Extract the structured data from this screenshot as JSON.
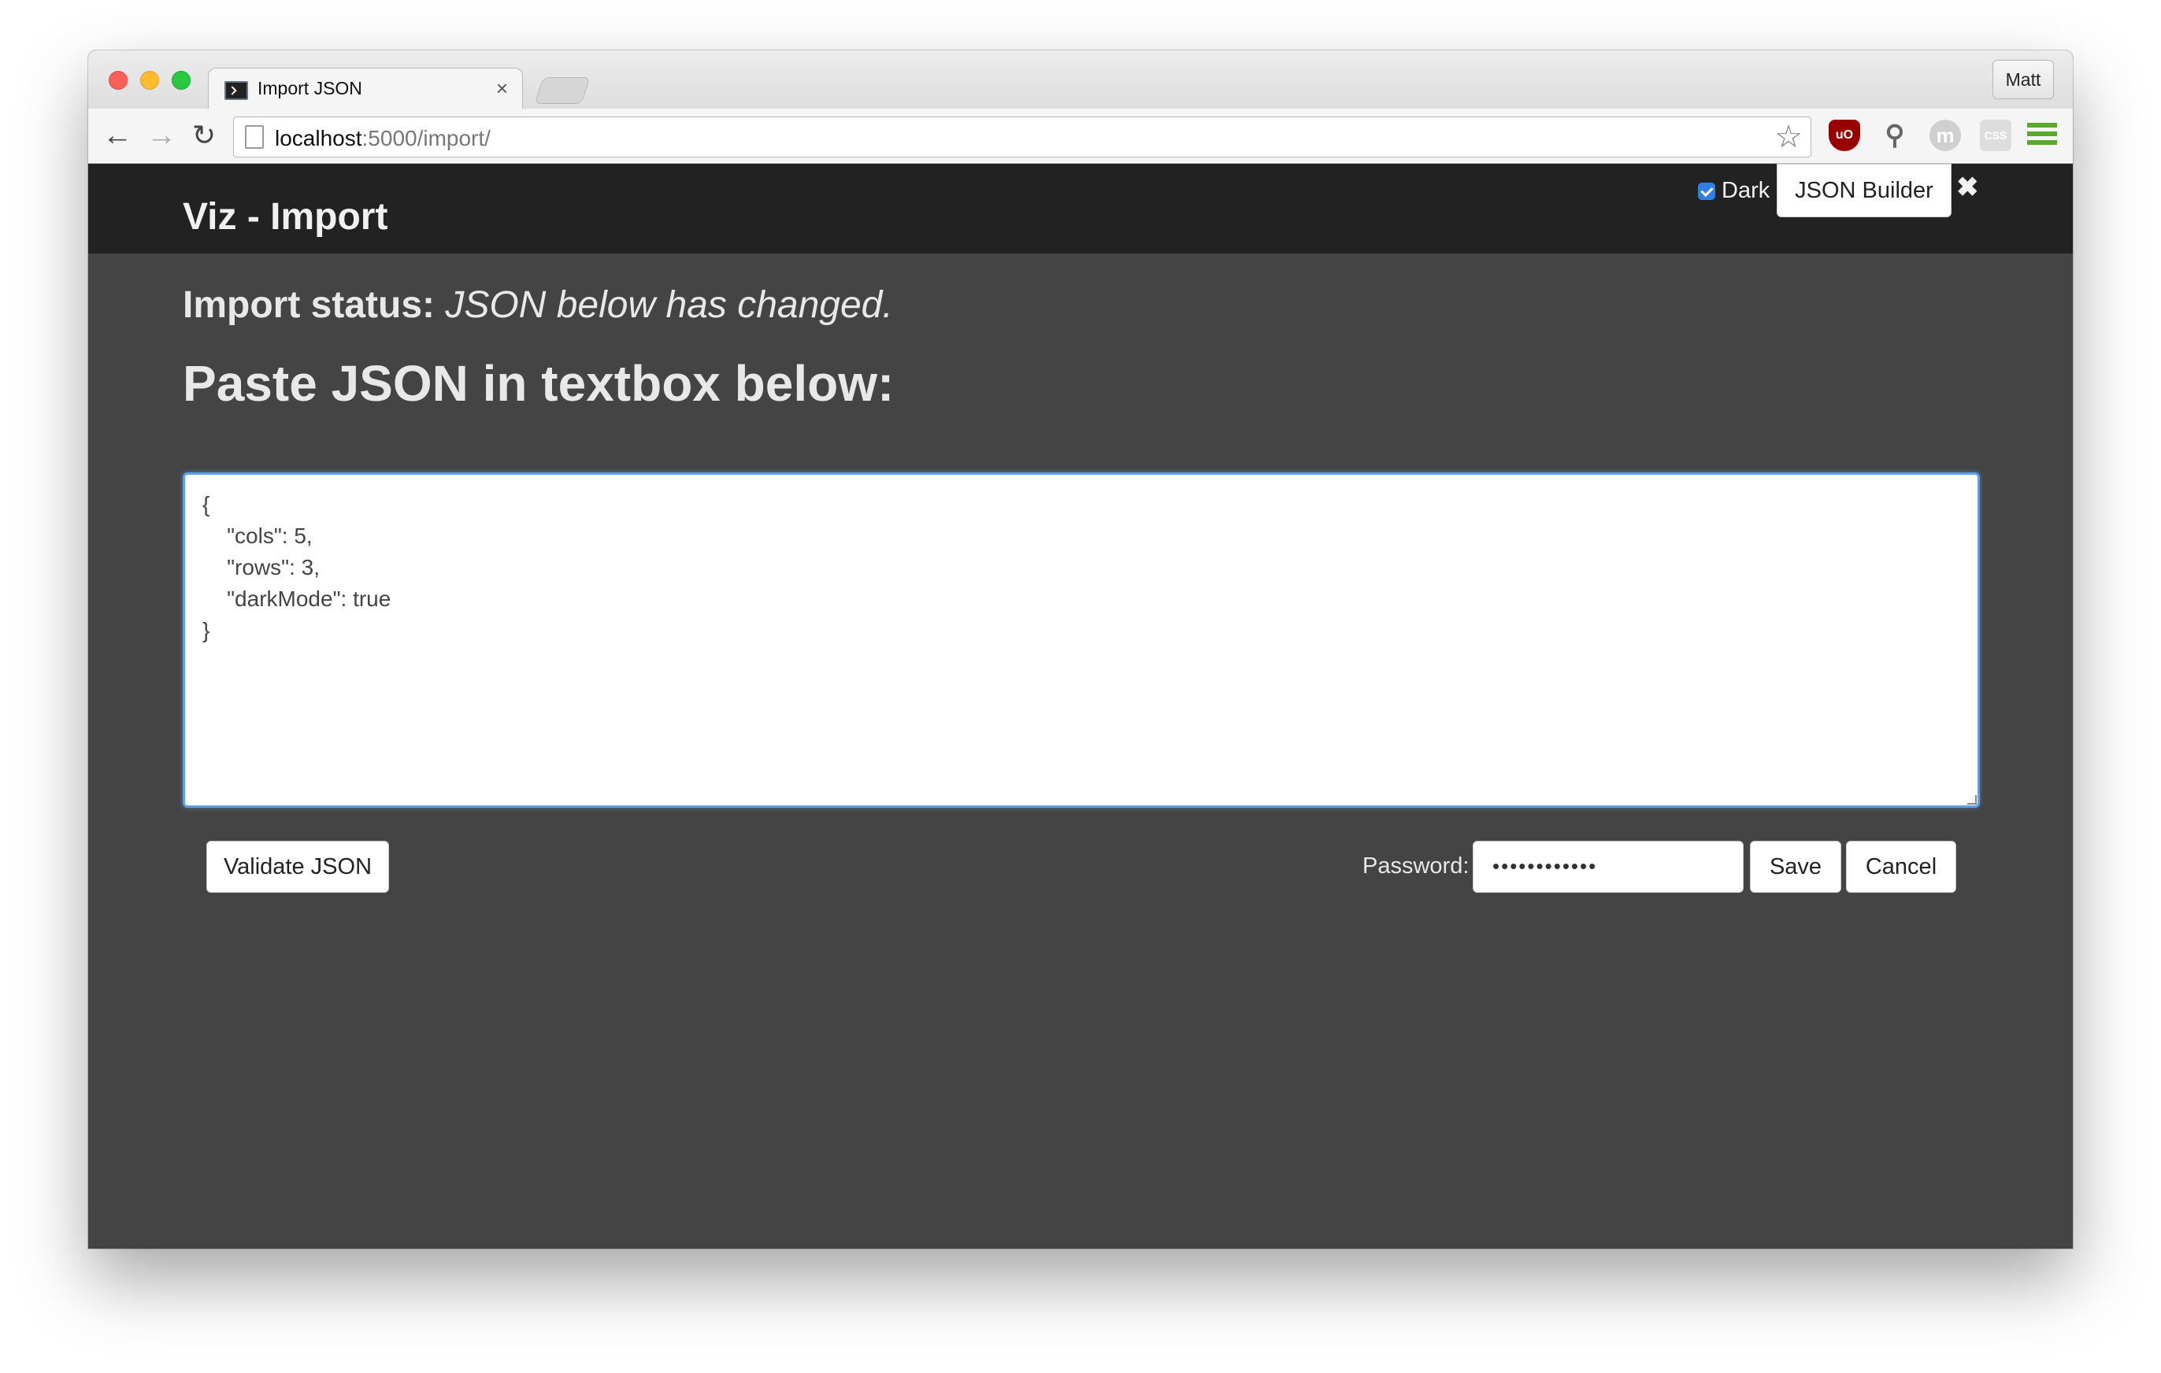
{
  "browser": {
    "tab_title": "Import JSON",
    "tab_close": "×",
    "profile": "Matt",
    "url_host": "localhost",
    "url_rest": ":5000/import/"
  },
  "header": {
    "title": "Viz - Import",
    "dark_label": "Dark",
    "dark_checked": true,
    "json_builder_label": "JSON Builder",
    "close_symbol": "✖"
  },
  "status": {
    "label": "Import status:",
    "value": "JSON below has changed."
  },
  "paste_heading": "Paste JSON in textbox below:",
  "json_text": "{\n    \"cols\": 5,\n    \"rows\": 3,\n    \"darkMode\": true\n}",
  "actions": {
    "validate_label": "Validate JSON",
    "password_label": "Password:",
    "password_value": "••••••••••••",
    "save_label": "Save",
    "cancel_label": "Cancel"
  },
  "colors": {
    "page_bg": "#444444",
    "header_bg": "#222222",
    "focus_border": "#5aa0e8",
    "checkbox": "#2f7fe8"
  }
}
